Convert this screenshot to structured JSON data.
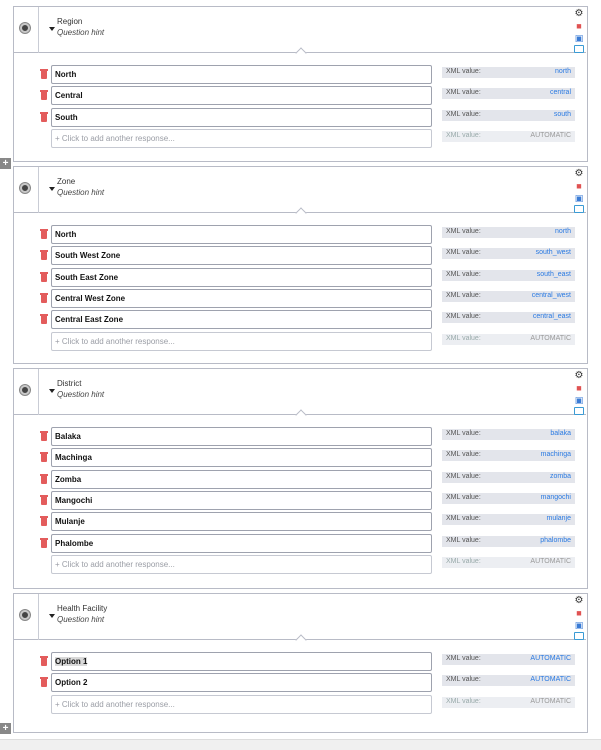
{
  "xml_label": "XML value:",
  "add_placeholder": "+ Click to add another response...",
  "auto_value": "AUTOMATIC",
  "add_question_symbol": "+",
  "questions": [
    {
      "label": "Region",
      "hint": "Question hint",
      "options": [
        {
          "label": "North",
          "xml": "north"
        },
        {
          "label": "Central",
          "xml": "central"
        },
        {
          "label": "South",
          "xml": "south"
        }
      ]
    },
    {
      "label": "Zone",
      "hint": "Question hint",
      "options": [
        {
          "label": "North",
          "xml": "north"
        },
        {
          "label": "South West Zone",
          "xml": "south_west"
        },
        {
          "label": "South East Zone",
          "xml": "south_east"
        },
        {
          "label": "Central West Zone",
          "xml": "central_west"
        },
        {
          "label": "Central East Zone",
          "xml": "central_east"
        }
      ]
    },
    {
      "label": "District",
      "hint": "Question hint",
      "options": [
        {
          "label": "Balaka",
          "xml": "balaka"
        },
        {
          "label": "Machinga",
          "xml": "machinga"
        },
        {
          "label": "Zomba",
          "xml": "zomba"
        },
        {
          "label": "Mangochi",
          "xml": "mangochi"
        },
        {
          "label": "Mulanje",
          "xml": "mulanje"
        },
        {
          "label": "Phalombe",
          "xml": "phalombe"
        }
      ]
    },
    {
      "label": "Health Facility",
      "hint": "Question hint",
      "options": [
        {
          "label": "Option 1",
          "xml": "AUTOMATIC",
          "selected": true
        },
        {
          "label": "Option 2",
          "xml": "AUTOMATIC"
        }
      ]
    }
  ],
  "icons": {
    "settings": "gear-icon",
    "delete": "trash-icon",
    "duplicate": "copy-icon",
    "library": "folder-icon"
  }
}
